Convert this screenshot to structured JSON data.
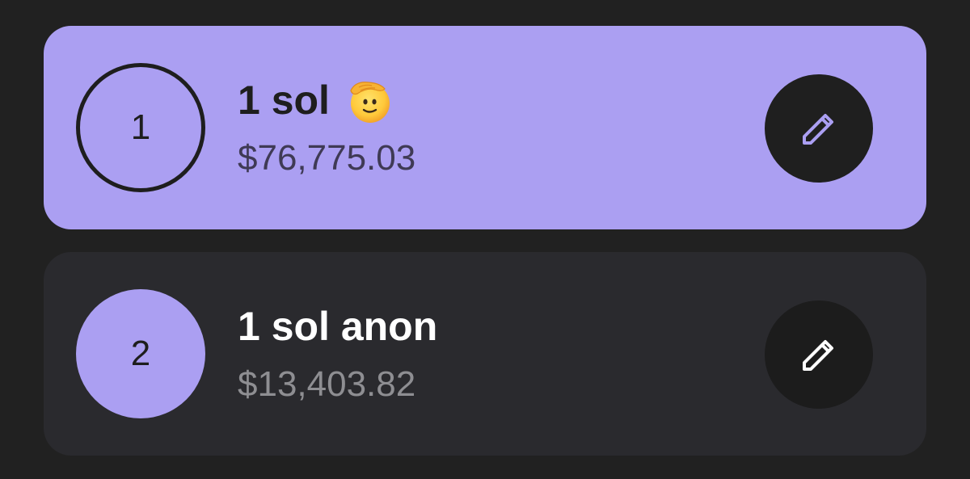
{
  "accounts": [
    {
      "index": "1",
      "name": "1 sol",
      "emoji": "saluting-face",
      "balance": "$76,775.03",
      "selected": true
    },
    {
      "index": "2",
      "name": "1 sol anon",
      "balance": "$13,403.82",
      "selected": false
    }
  ],
  "colors": {
    "background": "#212121",
    "accent": "#ab9ff2",
    "card": "#2a2a2e",
    "button": "#1f1f1f"
  },
  "icons": {
    "edit": "pencil-icon"
  }
}
